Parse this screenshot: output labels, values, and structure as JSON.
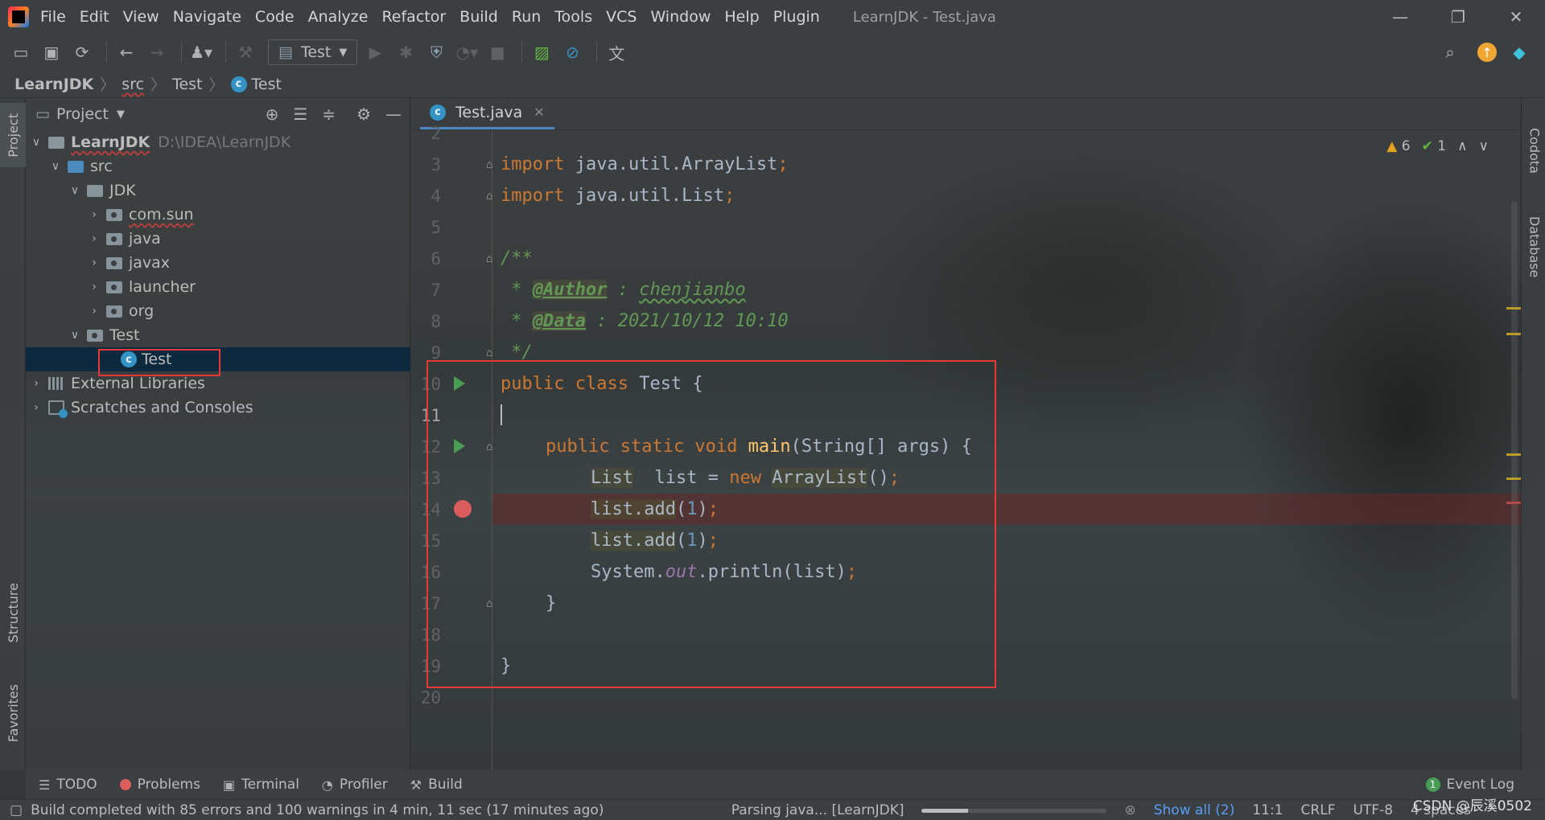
{
  "window": {
    "title": "LearnJDK - Test.java",
    "controls": [
      "—",
      "❐",
      "✕"
    ]
  },
  "menu": [
    "File",
    "Edit",
    "View",
    "Navigate",
    "Code",
    "Analyze",
    "Refactor",
    "Build",
    "Run",
    "Tools",
    "VCS",
    "Window",
    "Help",
    "Plugin"
  ],
  "toolbar": {
    "run_config": "Test"
  },
  "breadcrumb": {
    "project": "LearnJDK",
    "folder1": "src",
    "folder2": "Test",
    "file": "Test"
  },
  "left_stripe": {
    "project_tab": "Project",
    "structure_tab": "Structure",
    "favorites_tab": "Favorites"
  },
  "right_stripe": {
    "codota_tab": "Codota",
    "database_tab": "Database"
  },
  "project_panel": {
    "title": "Project",
    "tree": {
      "root": "LearnJDK",
      "root_path": "D:\\IDEA\\LearnJDK",
      "src": "src",
      "jdk": "JDK",
      "pkg_com_sun": "com.sun",
      "pkg_java": "java",
      "pkg_javax": "javax",
      "pkg_launcher": "launcher",
      "pkg_org": "org",
      "test_pkg": "Test",
      "test_class": "Test",
      "external_libs": "External Libraries",
      "scratches": "Scratches and Consoles"
    }
  },
  "editor": {
    "tab_label": "Test.java",
    "inspections": {
      "warnings": "6",
      "weak_warnings": "1"
    },
    "line_numbers": [
      "2",
      "3",
      "4",
      "5",
      "6",
      "7",
      "8",
      "9",
      "10",
      "11",
      "12",
      "13",
      "14",
      "15",
      "16",
      "17",
      "18",
      "19",
      "20"
    ],
    "code": {
      "l3_kw": "import",
      "l3_rest": " java.util.ArrayList",
      "l4_kw": "import",
      "l4_rest": " java.util.List",
      "l6": "/**",
      "l7_star": " * ",
      "l7_tag": "@Author",
      "l7_rest": " : ",
      "l7_name": "chenjianbo",
      "l8_star": " * ",
      "l8_tag": "@Data",
      "l8_rest": " : 2021/10/12 10:10",
      "l9": " */",
      "l10_kw": "public class",
      "l10_rest": " Test {",
      "l12_kw": "public static void",
      "l12_fn": "main",
      "l12_rest": "(String[] args) {",
      "l13_type": "List",
      "l13_mid": "  list = ",
      "l13_kw": "new",
      "l13_cls": "ArrayList",
      "l13_end": "()",
      "l14_call": "list.add",
      "l14_open": "(",
      "l14_num": "1",
      "l14_close": ")",
      "l15_call": "list.add",
      "l15_open": "(",
      "l15_num": "1",
      "l15_close": ")",
      "l16_a": "System.",
      "l16_static": "out",
      "l16_b": ".println(list)",
      "l17": "}",
      "l19": "}",
      "semicolon": ";"
    }
  },
  "bottom_tabs": {
    "todo": "TODO",
    "problems": "Problems",
    "terminal": "Terminal",
    "profiler": "Profiler",
    "build": "Build",
    "event_log": "Event Log",
    "event_count": "1"
  },
  "statusbar": {
    "message": "Build completed with 85 errors and 100 warnings in 4 min, 11 sec (17 minutes ago)",
    "task": "Parsing java... [LearnJDK]",
    "task_progress": 0.25,
    "show_all": "Show all (2)",
    "position": "11:1",
    "line_sep": "CRLF",
    "encoding": "UTF-8",
    "indent": "4 spaces"
  },
  "watermark": "CSDN @辰溪0502",
  "colors": {
    "keyword": "#cc7832",
    "function": "#ffc66d",
    "number": "#6897bb",
    "doc": "#629755",
    "highlight_box": "#e53935",
    "breakpoint": "#db5c5c"
  }
}
